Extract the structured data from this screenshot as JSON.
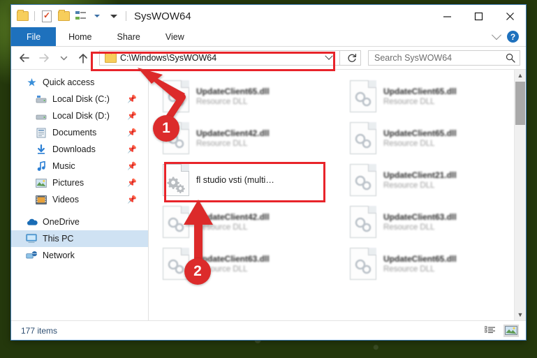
{
  "window": {
    "title": "SysWOW64",
    "controls": {
      "minimize": "minimize-button",
      "maximize": "maximize-button",
      "close": "close-button"
    }
  },
  "quick_access_toolbar": {
    "items": [
      "folder-icon",
      "properties-check-icon",
      "new-folder-icon",
      "customize-icon",
      "customize-caret-icon"
    ]
  },
  "ribbon": {
    "tabs": [
      {
        "label": "File",
        "active": true
      },
      {
        "label": "Home",
        "active": false
      },
      {
        "label": "Share",
        "active": false
      },
      {
        "label": "View",
        "active": false
      }
    ],
    "collapse_icon": "chevron-down-icon",
    "help_label": "?"
  },
  "address_bar": {
    "back_icon": "back-arrow-icon",
    "forward_icon": "forward-arrow-icon",
    "recent_icon": "recent-locations-caret-icon",
    "up_icon": "up-arrow-icon",
    "path": "C:\\Windows\\SysWOW64",
    "dropdown_icon": "chevron-down-icon",
    "refresh_icon": "refresh-icon"
  },
  "search": {
    "placeholder": "Search SysWOW64",
    "icon": "search-icon"
  },
  "sidebar": {
    "items": [
      {
        "label": "Quick access",
        "icon": "star-pin-icon",
        "indent": false,
        "pinned": false,
        "selected": false
      },
      {
        "label": "Local Disk (C:)",
        "icon": "drive-icon",
        "indent": true,
        "pinned": true,
        "selected": false
      },
      {
        "label": "Local Disk (D:)",
        "icon": "drive-icon",
        "indent": true,
        "pinned": true,
        "selected": false
      },
      {
        "label": "Documents",
        "icon": "documents-icon",
        "indent": true,
        "pinned": true,
        "selected": false
      },
      {
        "label": "Downloads",
        "icon": "downloads-icon",
        "indent": true,
        "pinned": true,
        "selected": false
      },
      {
        "label": "Music",
        "icon": "music-icon",
        "indent": true,
        "pinned": true,
        "selected": false
      },
      {
        "label": "Pictures",
        "icon": "pictures-icon",
        "indent": true,
        "pinned": true,
        "selected": false
      },
      {
        "label": "Videos",
        "icon": "videos-icon",
        "indent": true,
        "pinned": true,
        "selected": false
      },
      {
        "label": "OneDrive",
        "icon": "onedrive-icon",
        "indent": false,
        "pinned": false,
        "selected": false
      },
      {
        "label": "This PC",
        "icon": "this-pc-icon",
        "indent": false,
        "pinned": false,
        "selected": true
      },
      {
        "label": "Network",
        "icon": "network-icon",
        "indent": false,
        "pinned": false,
        "selected": false
      }
    ]
  },
  "files": {
    "column_left": [
      {
        "name": "UpdateClient65.dll",
        "sub": "Resource DLL",
        "icon": "dll-file-icon",
        "blurred": true,
        "highlighted": false
      },
      {
        "name": "UpdateClient42.dll",
        "sub": "Resource DLL",
        "icon": "dll-file-icon",
        "blurred": true,
        "highlighted": false
      },
      {
        "name": "fl studio vsti (multi…",
        "sub": "",
        "icon": "gears-file-icon",
        "blurred": false,
        "highlighted": true
      },
      {
        "name": "UpdateClient42.dll",
        "sub": "Resource DLL",
        "icon": "dll-file-icon",
        "blurred": true,
        "highlighted": false
      },
      {
        "name": "UpdateClient63.dll",
        "sub": "Resource DLL",
        "icon": "dll-file-icon",
        "blurred": true,
        "highlighted": false
      }
    ],
    "column_right": [
      {
        "name": "UpdateClient65.dll",
        "sub": "Resource DLL",
        "icon": "dll-file-icon",
        "blurred": true,
        "highlighted": false
      },
      {
        "name": "UpdateClient65.dll",
        "sub": "Resource DLL",
        "icon": "dll-file-icon",
        "blurred": true,
        "highlighted": false
      },
      {
        "name": "UpdateClient21.dll",
        "sub": "Resource DLL",
        "icon": "dll-file-icon",
        "blurred": true,
        "highlighted": false
      },
      {
        "name": "UpdateClient63.dll",
        "sub": "Resource DLL",
        "icon": "dll-file-icon",
        "blurred": true,
        "highlighted": false
      },
      {
        "name": "UpdateClient65.dll",
        "sub": "Resource DLL",
        "icon": "dll-file-icon",
        "blurred": true,
        "highlighted": false
      }
    ]
  },
  "status_bar": {
    "item_count": "177 items",
    "view_details_icon": "details-view-icon",
    "view_large_icons_icon": "large-icons-view-icon"
  },
  "annotations": {
    "accent_color": "#dc2b2b",
    "badges": [
      {
        "label": "1",
        "target": "address-bar"
      },
      {
        "label": "2",
        "target": "selected-file"
      }
    ]
  }
}
